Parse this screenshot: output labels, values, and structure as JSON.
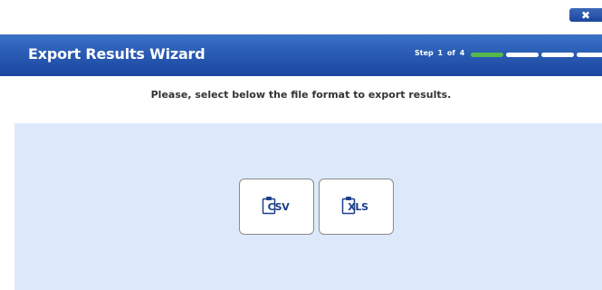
{
  "window": {
    "close_icon": "close-icon",
    "close_glyph": "✖"
  },
  "header": {
    "title": "Export Results Wizard",
    "step_word": "Step",
    "step_current": "1",
    "step_of": "of",
    "step_total": "4",
    "steps": [
      {
        "state": "active"
      },
      {
        "state": "inactive"
      },
      {
        "state": "inactive"
      },
      {
        "state": "inactive"
      }
    ],
    "colors": {
      "bar_top": "#3b73c7",
      "bar_bottom": "#1c46a0",
      "step_active": "#55b84a",
      "step_inactive": "#ffffff"
    }
  },
  "instruction": "Please, select below the file format to export results.",
  "formats": [
    {
      "label": "CSV",
      "icon": "clipboard-icon"
    },
    {
      "label": "XLS",
      "icon": "clipboard-icon"
    }
  ],
  "colors": {
    "content_bg": "#dde9fb",
    "icon_blue": "#1b3e88"
  }
}
